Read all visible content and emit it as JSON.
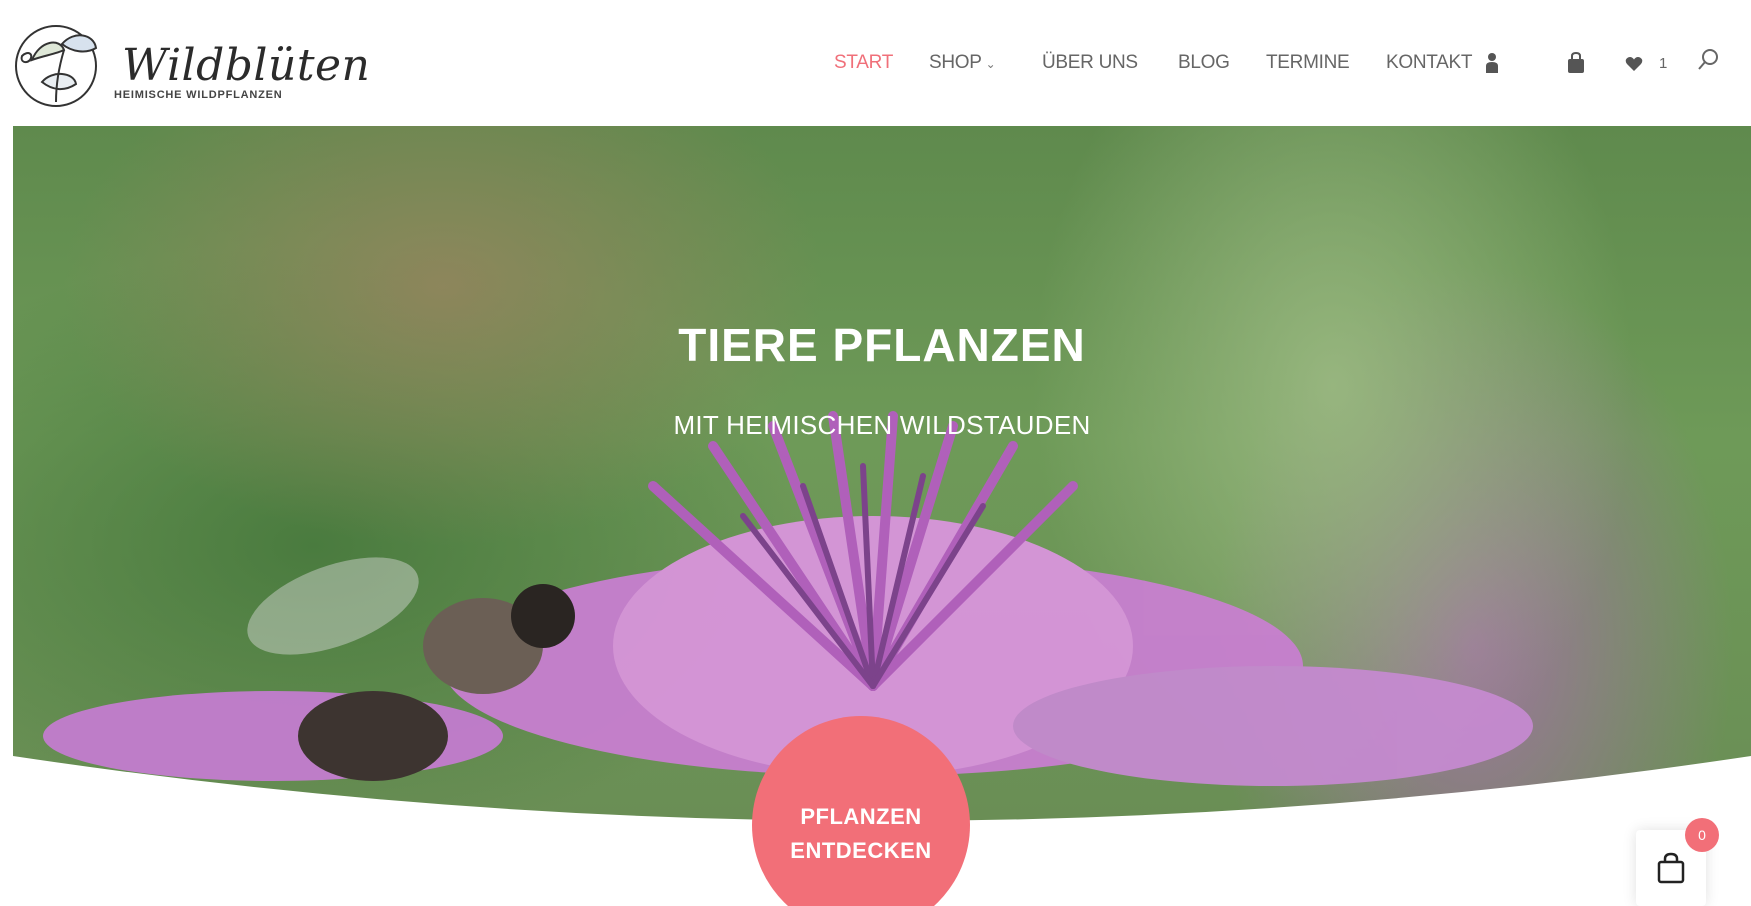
{
  "brand": {
    "name": "Wildblüten",
    "tagline": "HEIMISCHE WILDPFLANZEN"
  },
  "nav": {
    "items": [
      {
        "label": "START",
        "active": true
      },
      {
        "label": "SHOP",
        "has_dropdown": true
      },
      {
        "label": "ÜBER UNS"
      },
      {
        "label": "BLOG"
      },
      {
        "label": "TERMINE"
      },
      {
        "label": "KONTAKT"
      }
    ],
    "icons": [
      "user-icon",
      "bag-icon",
      "heart-icon",
      "search-icon"
    ],
    "wishlist_count": "1"
  },
  "hero": {
    "title": "TIERE PFLANZEN",
    "subtitle": "MIT HEIMISCHEN WILDSTAUDEN"
  },
  "cta": {
    "line1": "PFLANZEN",
    "line2": "ENTDECKEN"
  },
  "cart": {
    "count": "0"
  },
  "colors": {
    "accent": "#f26f78",
    "nav_text": "#666666"
  }
}
